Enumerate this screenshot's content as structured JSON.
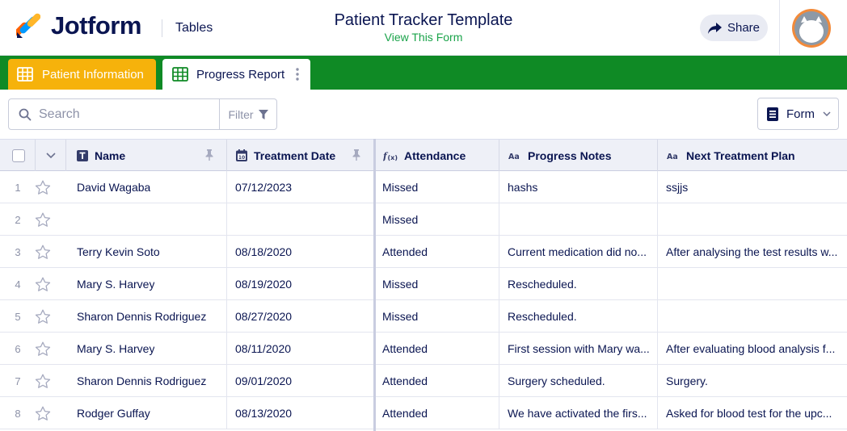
{
  "header": {
    "brand": "Jotform",
    "product": "Tables",
    "title": "Patient Tracker Template",
    "subtitle_link": "View This Form",
    "share_label": "Share"
  },
  "tabs": [
    {
      "label": "Patient Information",
      "active": false
    },
    {
      "label": "Progress Report",
      "active": true
    }
  ],
  "toolbar": {
    "search_placeholder": "Search",
    "filter_label": "Filter",
    "form_label": "Form"
  },
  "table": {
    "columns": [
      "Name",
      "Treatment Date",
      "Attendance",
      "Progress Notes",
      "Next Treatment Plan"
    ],
    "rows": [
      {
        "num": "1",
        "name": "David Wagaba",
        "date": "07/12/2023",
        "attendance": "Missed",
        "notes": "hashs",
        "plan": "ssjjs"
      },
      {
        "num": "2",
        "name": "",
        "date": "",
        "attendance": "Missed",
        "notes": "",
        "plan": ""
      },
      {
        "num": "3",
        "name": "Terry Kevin Soto",
        "date": "08/18/2020",
        "attendance": "Attended",
        "notes": "Current medication did no...",
        "plan": "After analysing the test results w..."
      },
      {
        "num": "4",
        "name": "Mary S. Harvey",
        "date": "08/19/2020",
        "attendance": "Missed",
        "notes": "Rescheduled.",
        "plan": ""
      },
      {
        "num": "5",
        "name": "Sharon Dennis Rodriguez",
        "date": "08/27/2020",
        "attendance": "Missed",
        "notes": "Rescheduled.",
        "plan": ""
      },
      {
        "num": "6",
        "name": "Mary S. Harvey",
        "date": "08/11/2020",
        "attendance": "Attended",
        "notes": "First session with Mary wa...",
        "plan": "After evaluating blood analysis f..."
      },
      {
        "num": "7",
        "name": "Sharon Dennis Rodriguez",
        "date": "09/01/2020",
        "attendance": "Attended",
        "notes": "Surgery scheduled.",
        "plan": "Surgery."
      },
      {
        "num": "8",
        "name": "Rodger Guffay",
        "date": "08/13/2020",
        "attendance": "Attended",
        "notes": "We have activated the firs...",
        "plan": "Asked for blood test for the upc..."
      }
    ]
  },
  "colors": {
    "tabbar_green": "#0f8a25",
    "active_tab_orange": "#f6b20b",
    "subtitle_green": "#1aa34a",
    "navy_text": "#0a1551",
    "avatar_orange": "#f28a3a"
  },
  "icons": {
    "logo": "jotform-logo-icon",
    "share": "share-arrow-icon",
    "table_tab": "grid-table-icon",
    "search": "search-icon",
    "filter": "filter-funnel-icon",
    "form": "form-document-icon",
    "pin": "pin-icon",
    "star": "star-icon"
  }
}
